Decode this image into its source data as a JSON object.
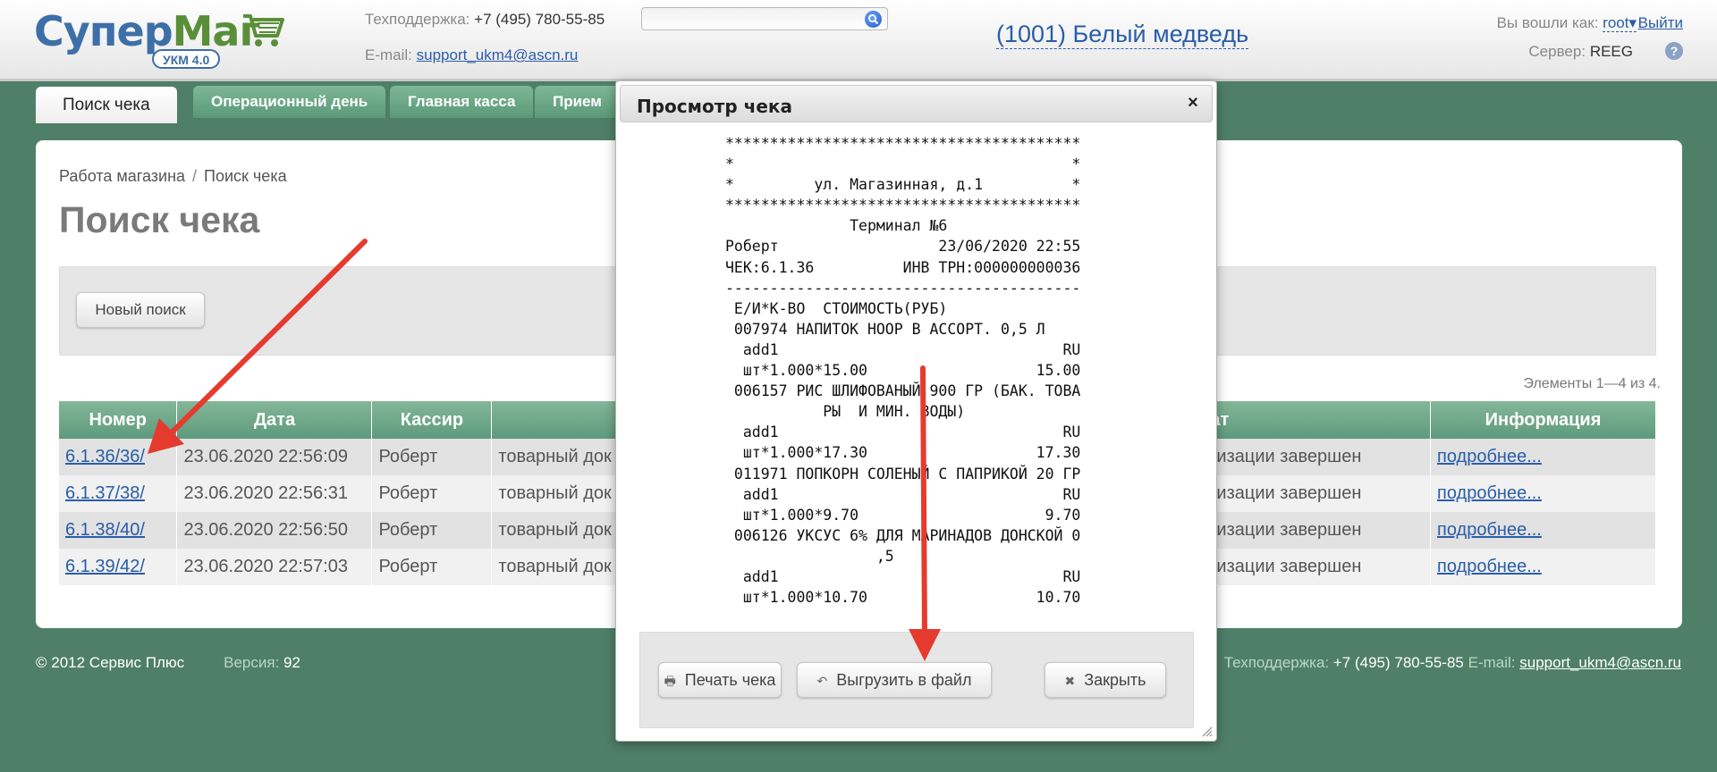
{
  "header": {
    "logo_text_a": "Супер",
    "logo_text_b": "Маг",
    "logo_badge": "УКМ 4.0",
    "support_label": "Техподдержка:",
    "support_phone": "+7 (495) 780-55-85",
    "email_label": "E-mail:",
    "email": "support_ukm4@ascn.ru",
    "search_placeholder": "",
    "store_name": "(1001) Белый медведь",
    "login_label": "Вы вошли как:",
    "user": "root",
    "logout": "Выйти",
    "server_label": "Сервер:",
    "server": "REEG",
    "help": "?"
  },
  "tabs": [
    {
      "label": "Поиск чека",
      "active": true
    },
    {
      "label": "Операционный день"
    },
    {
      "label": "Главная касса"
    },
    {
      "label": "Прием"
    }
  ],
  "main": {
    "breadcrumb_1": "Работа магазина",
    "breadcrumb_sep": "/",
    "breadcrumb_2": "Поиск чека",
    "title": "Поиск чека",
    "new_search": "Новый поиск",
    "count": "Элементы 1—4 из 4."
  },
  "table": {
    "headers": [
      "Номер",
      "Дата",
      "Кассир",
      "",
      "",
      "зультат",
      "Информация"
    ],
    "rows": [
      {
        "num": "6.1.36/36/",
        "date": "23.06.2020 22:56:09",
        "cashier": "Роберт",
        "doc": "товарный док",
        "result": "ентаризации завершен",
        "info": "подробнее..."
      },
      {
        "num": "6.1.37/38/",
        "date": "23.06.2020 22:56:31",
        "cashier": "Роберт",
        "doc": "товарный док",
        "result": "ентаризации завершен",
        "info": "подробнее..."
      },
      {
        "num": "6.1.38/40/",
        "date": "23.06.2020 22:56:50",
        "cashier": "Роберт",
        "doc": "товарный док",
        "result": "ентаризации завершен",
        "info": "подробнее..."
      },
      {
        "num": "6.1.39/42/",
        "date": "23.06.2020 22:57:03",
        "cashier": "Роберт",
        "doc": "товарный док",
        "result": "ентаризации завершен",
        "info": "подробнее..."
      }
    ]
  },
  "footer": {
    "copyright": "© 2012 Сервис Плюс",
    "version_label": "Версия:",
    "version": "92",
    "support_label": "Техподдержка:",
    "support_phone": "+7 (495) 780-55-85",
    "email_label": "E-mail:",
    "email": "support_ukm4@ascn.ru"
  },
  "modal": {
    "title": "Просмотр чека",
    "close_icon": "×",
    "receipt_lines": [
      "****************************************",
      "*                                      *",
      "*         ул. Магазинная, д.1          *",
      "****************************************",
      "              Терминал №6",
      "Роберт                  23/06/2020 22:55",
      "ЧЕК:6.1.36          ИНВ ТРН:000000000036",
      "----------------------------------------",
      " Е/И*К-ВО  СТОИМОСТЬ(РУБ)",
      " 007974 НАПИТОК НООР В АССОРТ. 0,5 Л",
      "  add1                                RU",
      "  шт*1.000*15.00                   15.00",
      " 006157 РИС ШЛИФОВАНЫЙ 900 ГР (БАК. ТОВА",
      "           РЫ  И МИН. ВОДЫ)",
      "  add1                                RU",
      "  шт*1.000*17.30                   17.30",
      " 011971 ПОПКОРН СОЛЕНЫЙ С ПАПРИКОЙ 20 ГР",
      "  add1                                RU",
      "  шт*1.000*9.70                     9.70",
      " 006126 УКСУС 6% ДЛЯ МАРИНАДОВ ДОНСКОЙ 0",
      "                 ,5",
      "  add1                                RU",
      "  шт*1.000*10.70                   10.70"
    ],
    "print_label": "Печать чека",
    "export_label": "Выгрузить в файл",
    "close_label": "Закрыть"
  },
  "colors": {
    "background": "#4f7f68",
    "tab_green": "#6aa786",
    "link": "#2a5da8",
    "arrow": "#e53b2f"
  }
}
